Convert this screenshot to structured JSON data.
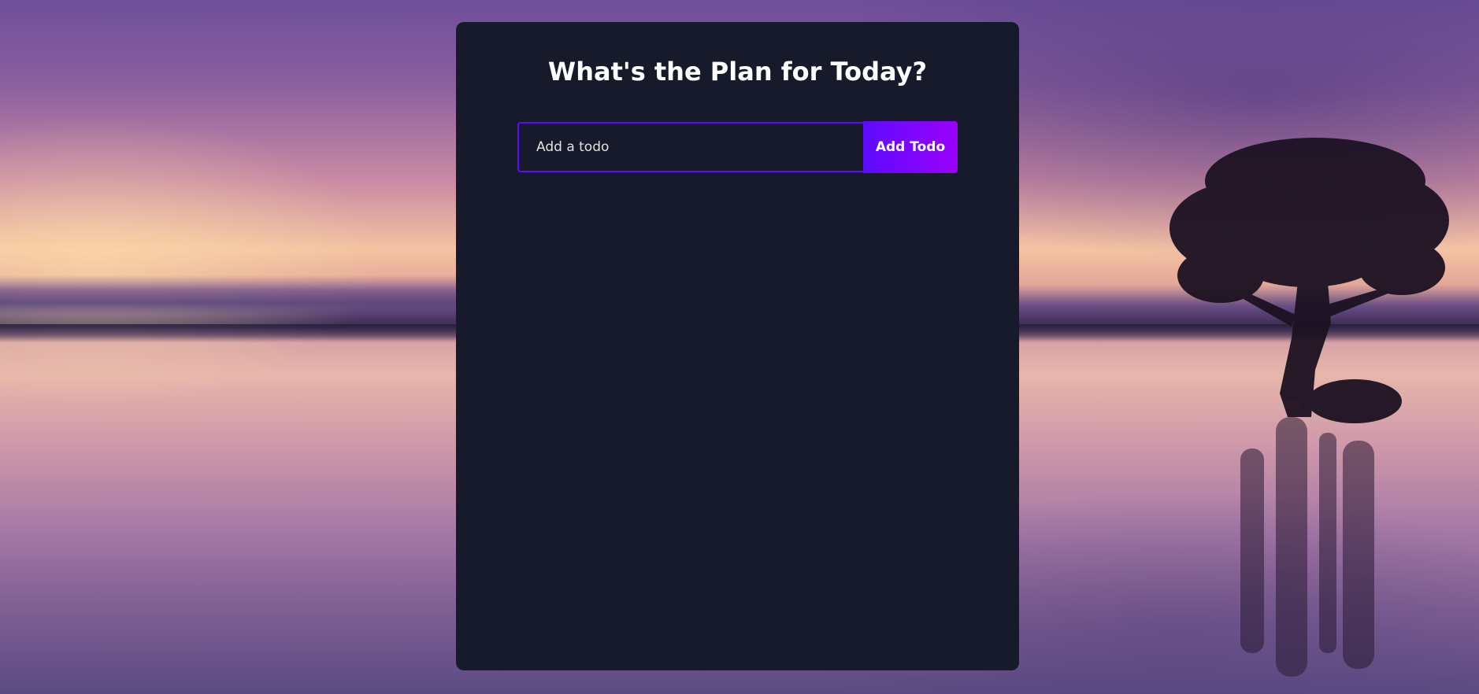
{
  "app": {
    "title": "What's the Plan for Today?"
  },
  "form": {
    "input_placeholder": "Add a todo",
    "input_value": "",
    "button_label": "Add Todo"
  },
  "todos": [],
  "colors": {
    "card_background": "#161a2b",
    "accent": "#5d0cff",
    "accent_gradient_end": "#9b00fa",
    "text": "#ffffff"
  },
  "background": {
    "image": "sunset-lake-with-tree"
  }
}
